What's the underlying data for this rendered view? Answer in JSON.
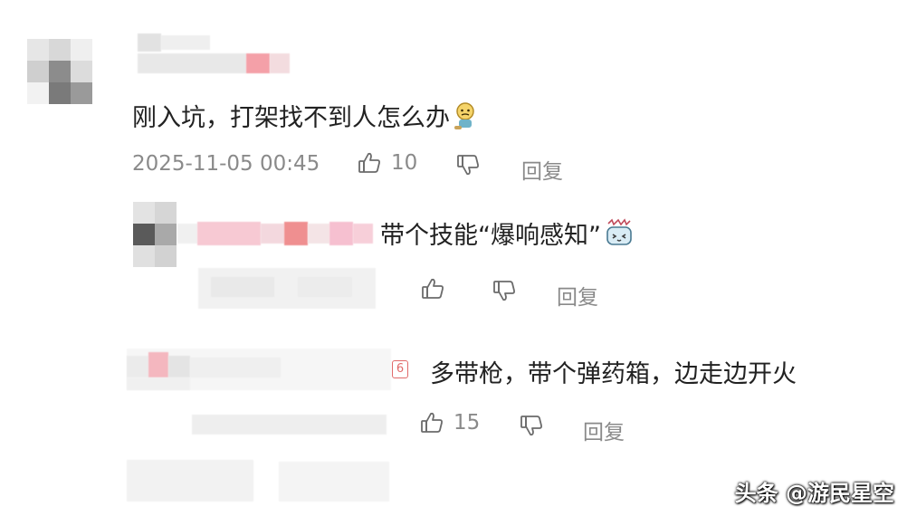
{
  "comment": {
    "text": "刚入坑，打架找不到人怎么办",
    "timestamp": "2025-11-05 00:45",
    "likes": "10",
    "reply_label": "回复"
  },
  "replies": [
    {
      "text": "带个技能“爆响感知”",
      "likes": "",
      "reply_label": "回复"
    },
    {
      "text": "多带枪，带个弹药箱，边走边开火",
      "likes": "15",
      "reply_label": "回复"
    }
  ],
  "watermark": "头条 @游民星空"
}
